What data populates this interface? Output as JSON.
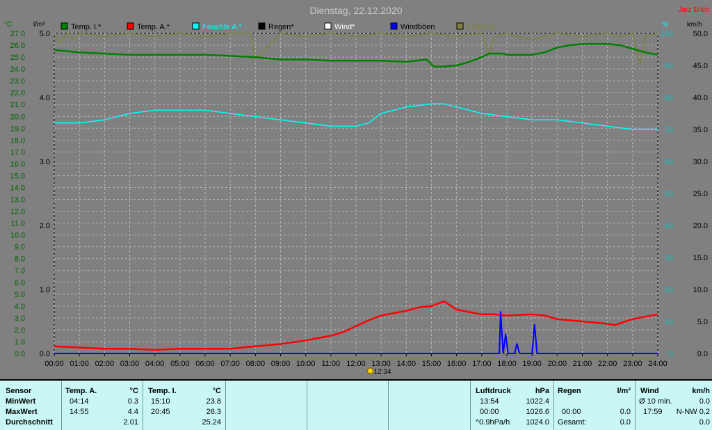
{
  "title": "Dienstag, 22.12.2020",
  "station_name": "Jarz Erich",
  "legend": [
    {
      "name": "Temp. I.*",
      "color": "#008000"
    },
    {
      "name": "Temp. A.*",
      "color": "#ff0000"
    },
    {
      "name": "Feuchte A.*",
      "color": "#00ffff"
    },
    {
      "name": "Regen*",
      "color": "#000000"
    },
    {
      "name": "Wind*",
      "color": "#ffffff"
    },
    {
      "name": "Windböen",
      "color": "#0000ff"
    },
    {
      "name": "Erdtemp.",
      "color": "#808040"
    }
  ],
  "units": {
    "temp": "°C",
    "rain": "l/m²",
    "humidity": "%",
    "wind": "km/h"
  },
  "marker_label": "12:34",
  "chart_data": {
    "type": "line",
    "title": "Dienstag, 22.12.2020",
    "x_ticks": [
      "00:00",
      "01:00",
      "02:00",
      "03:00",
      "04:00",
      "05:00",
      "06:00",
      "07:00",
      "08:00",
      "09:00",
      "10:00",
      "11:00",
      "12:00",
      "13:00",
      "14:00",
      "15:00",
      "16:00",
      "17:00",
      "18:00",
      "19:00",
      "20:00",
      "21:00",
      "22:00",
      "23:00",
      "24:00"
    ],
    "xlim": [
      0,
      24
    ],
    "axes": {
      "temp": {
        "range": [
          0,
          27
        ],
        "ticks": [
          "0.0",
          "1.0",
          "2.0",
          "3.0",
          "4.0",
          "5.0",
          "6.0",
          "7.0",
          "8.0",
          "9.0",
          "10.0",
          "11.0",
          "12.0",
          "13.0",
          "14.0",
          "15.0",
          "16.0",
          "17.0",
          "18.0",
          "19.0",
          "20.0",
          "21.0",
          "22.0",
          "23.0",
          "24.0",
          "25.0",
          "26.0",
          "27.0"
        ]
      },
      "rain": {
        "range": [
          0,
          5
        ],
        "ticks": [
          "0.0",
          "1.0",
          "2.0",
          "3.0",
          "4.0",
          "5.0"
        ]
      },
      "humidity": {
        "range": [
          0,
          100
        ],
        "ticks": [
          "0",
          "10",
          "20",
          "30",
          "40",
          "50",
          "60",
          "70",
          "80",
          "90",
          "100"
        ]
      },
      "wind": {
        "range": [
          0,
          50
        ],
        "ticks": [
          "0.0",
          "5.0",
          "10.0",
          "15.0",
          "20.0",
          "25.0",
          "30.0",
          "35.0",
          "40.0",
          "45.0",
          "50.0"
        ]
      }
    },
    "grid": true,
    "series": [
      {
        "name": "Temp. I.*",
        "axis": "temp",
        "color": "#008000",
        "x": [
          0,
          1,
          2,
          3,
          4,
          5,
          6,
          7,
          8,
          9,
          10,
          11,
          12,
          13,
          14,
          14.8,
          15.1,
          15.5,
          16,
          16.5,
          17,
          17.3,
          17.8,
          18,
          18.5,
          19,
          19.5,
          20,
          20.5,
          21,
          22,
          22.5,
          23,
          23.5,
          24
        ],
        "y": [
          25.6,
          25.4,
          25.3,
          25.2,
          25.2,
          25.2,
          25.2,
          25.1,
          25.0,
          24.8,
          24.8,
          24.7,
          24.7,
          24.7,
          24.6,
          24.8,
          24.2,
          24.2,
          24.3,
          24.6,
          25.0,
          25.3,
          25.3,
          25.2,
          25.2,
          25.2,
          25.4,
          25.8,
          26.0,
          26.1,
          26.1,
          26.0,
          25.7,
          25.4,
          25.2
        ]
      },
      {
        "name": "Temp. A.*",
        "axis": "temp",
        "color": "#ff0000",
        "x": [
          0,
          1,
          2,
          3,
          4,
          5,
          6,
          7,
          8,
          9,
          10,
          10.5,
          11,
          11.5,
          12,
          12.5,
          13,
          14,
          14.5,
          15,
          15.5,
          16,
          16.5,
          17,
          17.5,
          18,
          19,
          19.5,
          20,
          21,
          22,
          22.3,
          23,
          23.5,
          24
        ],
        "y": [
          0.6,
          0.5,
          0.4,
          0.4,
          0.3,
          0.4,
          0.4,
          0.4,
          0.6,
          0.8,
          1.1,
          1.3,
          1.5,
          1.8,
          2.3,
          2.8,
          3.2,
          3.6,
          3.9,
          4.0,
          4.4,
          3.7,
          3.5,
          3.3,
          3.3,
          3.2,
          3.3,
          3.2,
          2.9,
          2.7,
          2.5,
          2.4,
          2.9,
          3.1,
          3.3
        ]
      },
      {
        "name": "Feuchte A.*",
        "axis": "humidity",
        "color": "#00ffff",
        "x": [
          0,
          1,
          2,
          3,
          4,
          5,
          6,
          7,
          8,
          9,
          10,
          11,
          12,
          12.5,
          13,
          14,
          15,
          15.5,
          16,
          17,
          18,
          19,
          20,
          21,
          22,
          23,
          24
        ],
        "y": [
          72,
          72,
          73,
          75,
          76,
          76,
          76,
          75,
          74,
          73,
          72,
          71,
          71,
          72,
          75,
          77,
          78,
          78,
          77,
          75,
          74,
          73,
          73,
          72,
          71,
          70,
          70
        ]
      },
      {
        "name": "Windböen",
        "axis": "wind",
        "color": "#0000ff",
        "x": [
          0,
          17.7,
          17.75,
          17.85,
          17.95,
          18.05,
          18.3,
          18.4,
          18.5,
          18.6,
          19.0,
          19.1,
          19.2,
          19.4,
          24
        ],
        "y": [
          0,
          0,
          6.5,
          0,
          3,
          0,
          0,
          1.5,
          0,
          0,
          0,
          4.5,
          0,
          0,
          0
        ]
      },
      {
        "name": "Erdtemp.",
        "axis": "humidity",
        "color": "#808040",
        "x": [
          0,
          0.2,
          0.4,
          0.6,
          0.8,
          1,
          2,
          3,
          4,
          5,
          6,
          7,
          7.8,
          8,
          9,
          10,
          11,
          12,
          13,
          14,
          15,
          16,
          17,
          17.3,
          17.5,
          18,
          19,
          20,
          21,
          22,
          22.5,
          23,
          23.3,
          23.5,
          24
        ],
        "y": [
          100,
          97,
          99,
          100,
          98,
          100,
          99,
          100,
          99,
          100,
          99,
          100,
          100,
          92,
          100,
          99,
          100,
          99,
          100,
          99,
          100,
          99,
          100,
          93,
          99,
          100,
          98,
          100,
          99,
          100,
          99,
          100,
          90,
          99,
          100
        ]
      }
    ]
  },
  "stats": {
    "headers": {
      "sensor": "Sensor",
      "temp_a": "Temp. A.",
      "temp_a_unit": "°C",
      "temp_i": "Temp. I.",
      "temp_i_unit": "°C",
      "pressure": "Luftdruck",
      "pressure_unit": "hPa",
      "rain": "Regen",
      "rain_unit": "l/m²",
      "wind": "Wind",
      "wind_unit": "km/h"
    },
    "rows": [
      {
        "label": "MinWert",
        "ta_time": "04:14",
        "ta_val": "0.3",
        "ti_time": "15:10",
        "ti_val": "23.8",
        "p_time": "13:54",
        "p_val": "1022.4",
        "r_time": "",
        "r_val": "",
        "w_time": "Ø 10 min.",
        "w_val": "0.0"
      },
      {
        "label": "MaxWert",
        "ta_time": "14:55",
        "ta_val": "4.4",
        "ti_time": "20:45",
        "ti_val": "26.3",
        "p_time": "00:00",
        "p_val": "1026.6",
        "r_time": "00:00",
        "r_val": "0.0",
        "w_time": "17:59",
        "w_val": "N-NW 0.2"
      },
      {
        "label": "Durchschnitt",
        "ta_time": "",
        "ta_val": "2.01",
        "ti_time": "",
        "ti_val": "25.24",
        "p_time": "^0.9hPa/h",
        "p_val": "1024.0",
        "r_time": "Gesamt:",
        "r_val": "0.0",
        "w_time": "",
        "w_val": "0.0"
      }
    ]
  }
}
